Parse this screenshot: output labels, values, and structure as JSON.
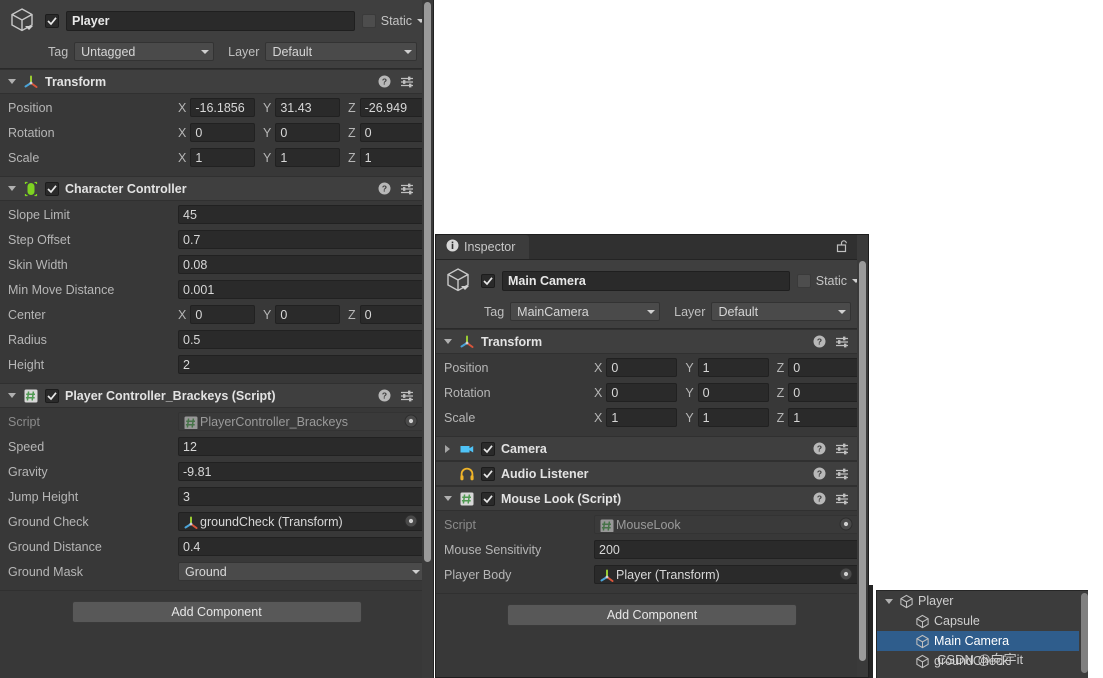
{
  "colors": {
    "panel_bg": "#383838",
    "header_bg": "#3f3f3f",
    "field_bg": "#2a2a2a",
    "selection_blue": "#2f5d8c",
    "script_green": "#6fbf73",
    "capsule_green": "#7ed321",
    "camera_blue": "#4fc3f7",
    "headphone_yellow": "#f0b429"
  },
  "inspector_player": {
    "game_object": {
      "enabled": true,
      "name": "Player",
      "static_label": "Static",
      "static_checked": false,
      "tag_label": "Tag",
      "tag_value": "Untagged",
      "layer_label": "Layer",
      "layer_value": "Default",
      "icon": "cube-icon"
    },
    "components": [
      {
        "id": "transform",
        "title": "Transform",
        "icon": "transform-axis-icon",
        "has_checkbox": false,
        "expanded": true,
        "rows": [
          {
            "type": "vector3",
            "label": "Position",
            "x": "-16.1856",
            "y": "31.43",
            "z": "-26.949"
          },
          {
            "type": "vector3",
            "label": "Rotation",
            "x": "0",
            "y": "0",
            "z": "0"
          },
          {
            "type": "vector3",
            "label": "Scale",
            "x": "1",
            "y": "1",
            "z": "1"
          }
        ]
      },
      {
        "id": "character-controller",
        "title": "Character Controller",
        "icon": "capsule-collider-icon",
        "has_checkbox": true,
        "checked": true,
        "expanded": true,
        "rows": [
          {
            "type": "text",
            "label": "Slope Limit",
            "value": "45"
          },
          {
            "type": "text",
            "label": "Step Offset",
            "value": "0.7"
          },
          {
            "type": "text",
            "label": "Skin Width",
            "value": "0.08"
          },
          {
            "type": "text",
            "label": "Min Move Distance",
            "value": "0.001"
          },
          {
            "type": "vector3",
            "label": "Center",
            "x": "0",
            "y": "0",
            "z": "0"
          },
          {
            "type": "text",
            "label": "Radius",
            "value": "0.5"
          },
          {
            "type": "text",
            "label": "Height",
            "value": "2"
          }
        ]
      },
      {
        "id": "player-controller-brackeys",
        "title": "Player Controller_Brackeys (Script)",
        "icon": "script-icon",
        "has_checkbox": true,
        "checked": true,
        "expanded": true,
        "rows": [
          {
            "type": "object",
            "label": "Script",
            "value": "PlayerController_Brackeys",
            "obj_icon": "script-icon",
            "readonly": true
          },
          {
            "type": "text",
            "label": "Speed",
            "value": "12"
          },
          {
            "type": "text",
            "label": "Gravity",
            "value": "-9.81"
          },
          {
            "type": "text",
            "label": "Jump Height",
            "value": "3"
          },
          {
            "type": "object",
            "label": "Ground Check",
            "value": "groundCheck (Transform)",
            "obj_icon": "transform-axis-icon",
            "readonly": false
          },
          {
            "type": "text",
            "label": "Ground Distance",
            "value": "0.4"
          },
          {
            "type": "select",
            "label": "Ground Mask",
            "value": "Ground"
          }
        ]
      }
    ],
    "add_component_label": "Add Component"
  },
  "inspector_camera": {
    "tab": {
      "label": "Inspector",
      "icon": "info-icon",
      "lock_icon": "lock-open-icon",
      "menu_icon": "kebab-menu-icon"
    },
    "game_object": {
      "enabled": true,
      "name": "Main Camera",
      "static_label": "Static",
      "static_checked": false,
      "tag_label": "Tag",
      "tag_value": "MainCamera",
      "layer_label": "Layer",
      "layer_value": "Default",
      "icon": "cube-icon"
    },
    "components": [
      {
        "id": "transform",
        "title": "Transform",
        "icon": "transform-axis-icon",
        "has_checkbox": false,
        "expanded": true,
        "rows": [
          {
            "type": "vector3",
            "label": "Position",
            "x": "0",
            "y": "1",
            "z": "0"
          },
          {
            "type": "vector3",
            "label": "Rotation",
            "x": "0",
            "y": "0",
            "z": "0"
          },
          {
            "type": "vector3",
            "label": "Scale",
            "x": "1",
            "y": "1",
            "z": "1"
          }
        ]
      },
      {
        "id": "camera",
        "title": "Camera",
        "icon": "camera-icon",
        "has_checkbox": true,
        "checked": true,
        "expanded": false,
        "rows": []
      },
      {
        "id": "audio-listener",
        "title": "Audio Listener",
        "icon": "headphones-icon",
        "has_checkbox": true,
        "checked": true,
        "expanded": false,
        "no_foldout": true,
        "rows": []
      },
      {
        "id": "mouse-look",
        "title": "Mouse Look (Script)",
        "icon": "script-icon",
        "has_checkbox": true,
        "checked": true,
        "expanded": true,
        "rows": [
          {
            "type": "object",
            "label": "Script",
            "value": "MouseLook",
            "obj_icon": "script-icon",
            "readonly": true
          },
          {
            "type": "text",
            "label": "Mouse Sensitivity",
            "value": "200"
          },
          {
            "type": "object",
            "label": "Player Body",
            "value": "Player (Transform)",
            "obj_icon": "transform-axis-icon",
            "readonly": false
          }
        ]
      }
    ],
    "add_component_label": "Add Component"
  },
  "hierarchy": {
    "items": [
      {
        "label": "Player",
        "depth": 1,
        "expanded": true,
        "selected": false,
        "icon": "cube-icon"
      },
      {
        "label": "Capsule",
        "depth": 2,
        "expanded": false,
        "selected": false,
        "icon": "cube-icon"
      },
      {
        "label": "Main Camera",
        "depth": 2,
        "expanded": false,
        "selected": true,
        "icon": "cube-icon"
      },
      {
        "label": "groundCheck",
        "depth": 2,
        "expanded": false,
        "selected": false,
        "icon": "cube-icon"
      }
    ],
    "watermark": "CSDN @向宇it"
  }
}
